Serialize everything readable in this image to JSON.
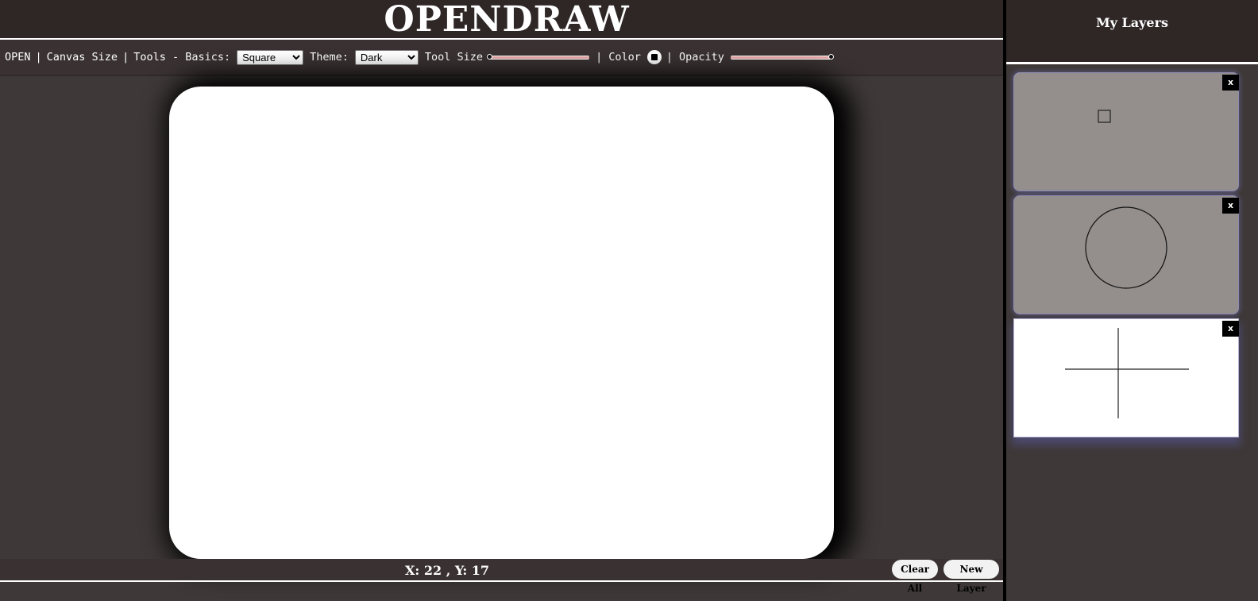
{
  "header": {
    "title": "OPENDRAW"
  },
  "toolbar": {
    "open_label": "OPEN",
    "separator": "|",
    "canvas_size_label": "Canvas Size",
    "tools_label": "Tools - Basics:",
    "tool_selected": "Square",
    "theme_label": "Theme:",
    "theme_selected": "Dark",
    "tool_size_label": "Tool Size",
    "tool_size_value": 0,
    "color_label": "Color",
    "color_value": "#000000",
    "opacity_label": "Opacity",
    "opacity_value": 1
  },
  "statusbar": {
    "coords": "X: 22 , Y: 17",
    "clear_all_label": "Clear All",
    "new_layer_label": "New Layer"
  },
  "layers_panel": {
    "title": "My Layers",
    "layers": [
      {
        "thumbnail": "square",
        "delete_label": "x",
        "active": false
      },
      {
        "thumbnail": "circle",
        "delete_label": "x",
        "active": false
      },
      {
        "thumbnail": "cross",
        "delete_label": "x",
        "active": true
      }
    ]
  },
  "colors": {
    "header_bg": "#2f2626",
    "page_bg": "#3e3838",
    "canvas_bg": "#ffffff",
    "slider_track": "#e8a8a8",
    "layer_inactive_bg": "#948e8d",
    "layer_active_bg": "#ffffff"
  }
}
